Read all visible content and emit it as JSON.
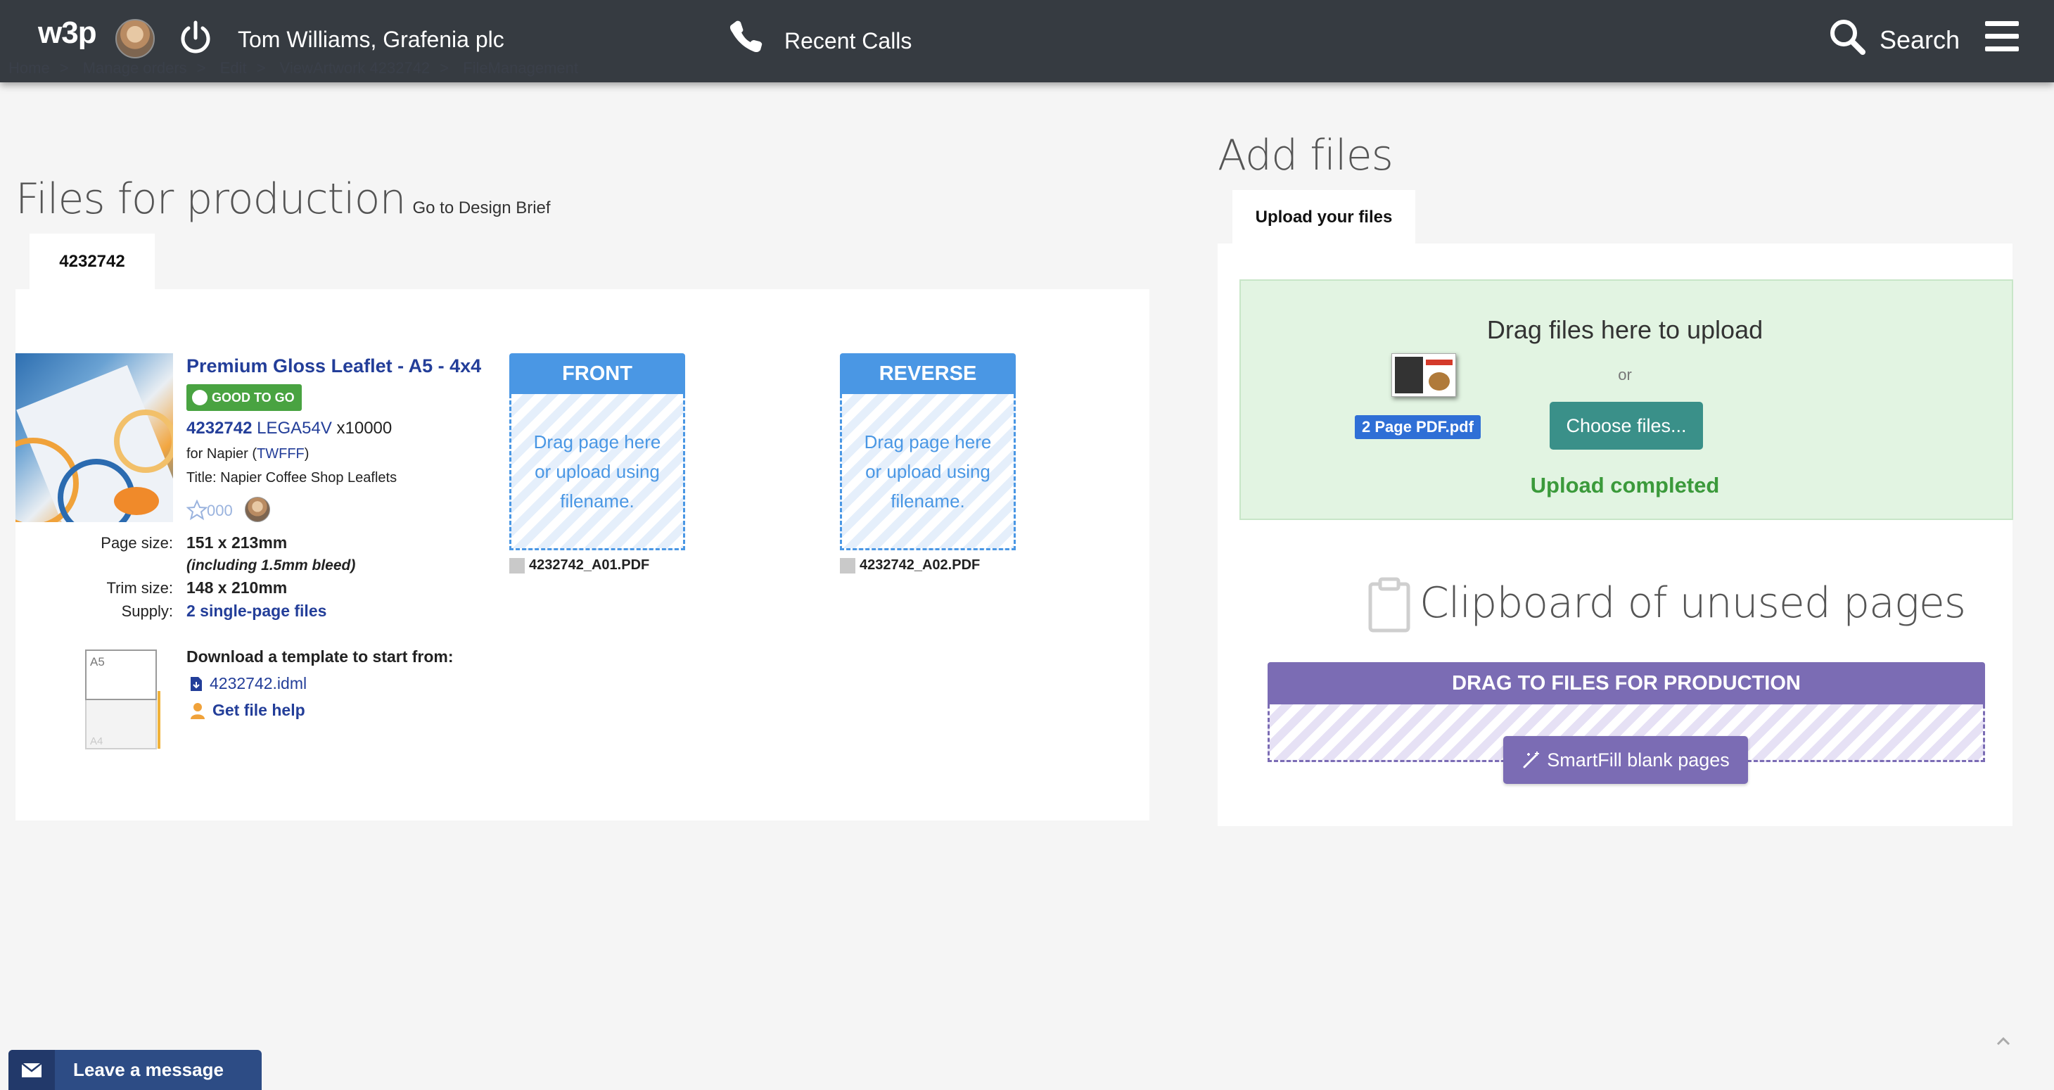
{
  "topbar": {
    "logo": "w3p",
    "user_name": "Tom Williams, Grafenia plc",
    "recent_calls": "Recent Calls",
    "search": "Search"
  },
  "breadcrumb": [
    "Home",
    "Manage orders",
    "Edit",
    "ViewArtwork 4232742",
    "FileManagement"
  ],
  "left": {
    "title": "Files for production",
    "brief_link": "Go to Design Brief",
    "tab": "4232742",
    "product": {
      "title": "Premium Gloss Leaflet - A5 - 4x4",
      "badge": "GOOD TO GO",
      "job_number": "4232742",
      "job_code": "LEGA54V",
      "quantity": "x10000",
      "for_prefix": "for Napier (",
      "customer_code": "TWFFF",
      "for_suffix": ")",
      "title_line": "Title: Napier Coffee Shop Leaflets",
      "rating": "000"
    },
    "specs": {
      "page_size_label": "Page size:",
      "page_size": "151 x 213mm",
      "bleed": "(including 1.5mm bleed)",
      "trim_size_label": "Trim size:",
      "trim_size": "148 x 210mm",
      "supply_label": "Supply:",
      "supply": "2 single-page files"
    },
    "template": {
      "label": "Download a template to start from:",
      "idml": "4232742.idml",
      "help": "Get file help",
      "size_top": "A5",
      "size_bottom": "A4"
    },
    "slots": [
      {
        "head": "FRONT",
        "body": "Drag page here or upload using filename.",
        "file": "4232742_A01.PDF"
      },
      {
        "head": "REVERSE",
        "body": "Drag page here or upload using filename.",
        "file": "4232742_A02.PDF"
      }
    ],
    "colors": {
      "slot_blue": "#4a97e4",
      "link_blue": "#233e99",
      "good_green": "#49a341"
    }
  },
  "right": {
    "title": "Add files",
    "tab": "Upload your files",
    "drag_title": "Drag files here to upload",
    "or": "or",
    "file_name": "2 Page PDF.pdf",
    "choose_button": "Choose files...",
    "status": "Upload completed",
    "clipboard_title": "Clipboard of unused pages",
    "clipboard_head": "DRAG TO FILES FOR PRODUCTION",
    "smartfill_button": "SmartFill blank pages",
    "colors": {
      "teal": "#3a9089",
      "purple": "#7b6cb4",
      "green_zone": "#e2f4e2"
    }
  },
  "chat": {
    "label": "Leave a message"
  }
}
